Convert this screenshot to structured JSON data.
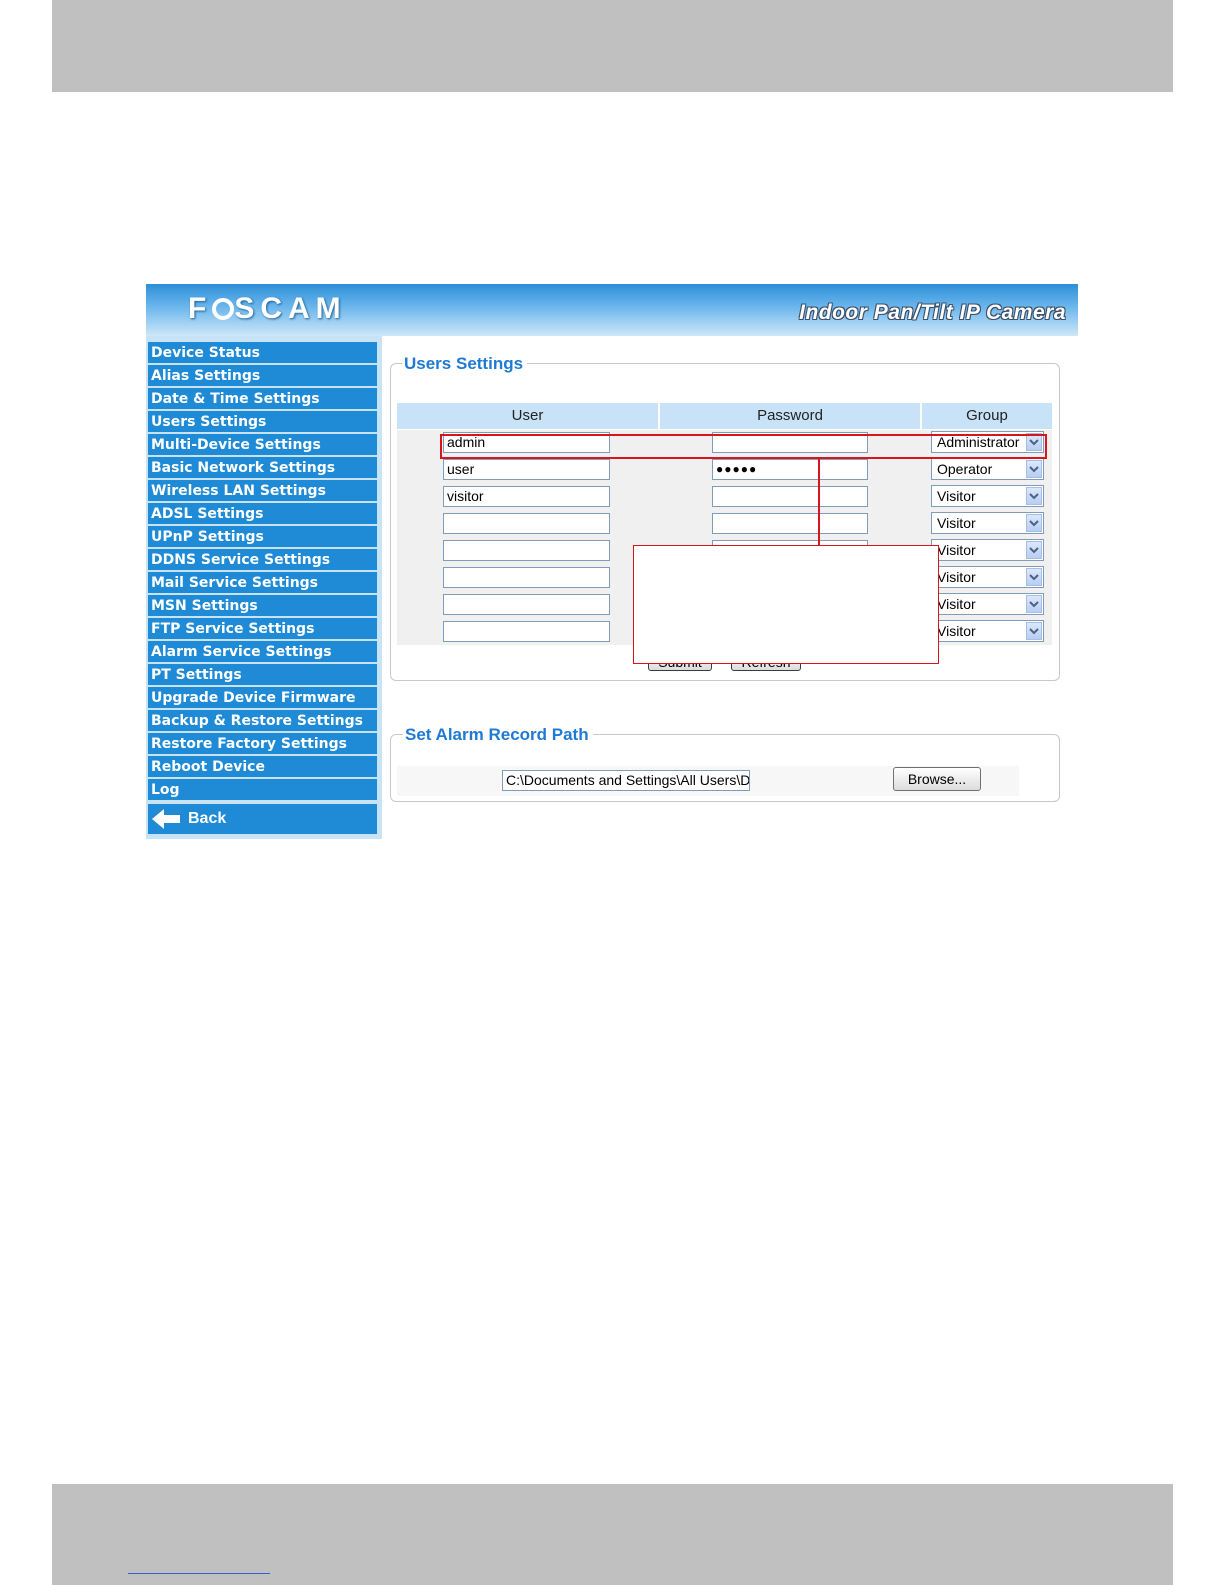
{
  "header": {
    "brand": "F",
    "brand_rest": "SCAM",
    "product": "Indoor Pan/Tilt IP Camera"
  },
  "sidebar": {
    "items": [
      {
        "label": "Device Status"
      },
      {
        "label": "Alias Settings"
      },
      {
        "label": "Date & Time Settings"
      },
      {
        "label": "Users Settings"
      },
      {
        "label": "Multi-Device Settings"
      },
      {
        "label": "Basic Network Settings"
      },
      {
        "label": "Wireless LAN Settings"
      },
      {
        "label": "ADSL Settings"
      },
      {
        "label": "UPnP Settings"
      },
      {
        "label": "DDNS Service Settings"
      },
      {
        "label": "Mail Service Settings"
      },
      {
        "label": "MSN Settings"
      },
      {
        "label": "FTP Service Settings"
      },
      {
        "label": "Alarm Service Settings"
      },
      {
        "label": "PT Settings"
      },
      {
        "label": "Upgrade Device Firmware"
      },
      {
        "label": "Backup & Restore Settings"
      },
      {
        "label": "Restore Factory Settings"
      },
      {
        "label": "Reboot Device"
      },
      {
        "label": "Log"
      }
    ],
    "back_label": "Back"
  },
  "users_panel": {
    "title": "Users Settings",
    "columns": {
      "user": "User",
      "password": "Password",
      "group": "Group"
    },
    "rows": [
      {
        "user": "admin",
        "password": "",
        "group": "Administrator"
      },
      {
        "user": "user",
        "password": "●●●●●",
        "group": "Operator"
      },
      {
        "user": "visitor",
        "password": "",
        "group": "Visitor"
      },
      {
        "user": "",
        "password": "",
        "group": "Visitor"
      },
      {
        "user": "",
        "password": "",
        "group": "Visitor"
      },
      {
        "user": "",
        "password": "",
        "group": "Visitor"
      },
      {
        "user": "",
        "password": "",
        "group": "Visitor"
      },
      {
        "user": "",
        "password": "",
        "group": "Visitor"
      }
    ],
    "submit_label": "Submit",
    "refresh_label": "Refresh"
  },
  "alarm_panel": {
    "title": "Set Alarm Record Path",
    "path_value": "C:\\Documents and Settings\\All Users\\D",
    "browse_label": "Browse..."
  },
  "colors": {
    "menu_bg": "#1f8ad6",
    "legend_text": "#1f7ad3",
    "highlight": "#d8141c"
  }
}
